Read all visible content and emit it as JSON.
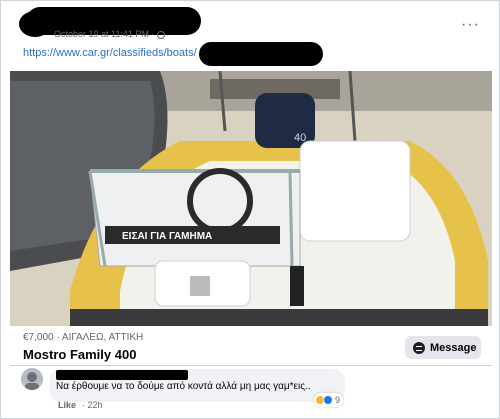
{
  "post": {
    "timestamp": "October 19 at 11:41 PM · ",
    "link_text": "https://www.car.gr/classifieds/boats/",
    "more_icon": "more-horizontal-icon"
  },
  "listing": {
    "price": "€7,000 · ΑΙΓΑΛΕΩ, ΑΤΤΙΚΗ",
    "title": "Mostro Family 400",
    "message_label": "Message",
    "photo_sign_text": "ΕΙΣΑΙ ΓΙΑ ΓΑΜΗΜΑ",
    "engine_label": "40"
  },
  "comment": {
    "text": "Να έρθουμε να το δούμε από κοντά αλλά μη μας γαμ*εις..",
    "like_label": "Like",
    "time_ago": "· 22h",
    "reaction_count": "9",
    "reactions": [
      "haha-icon",
      "like-icon"
    ]
  },
  "colors": {
    "link": "#2a6fc9",
    "boat_yellow": "#e6c24a",
    "secondary_text": "#65676b"
  }
}
